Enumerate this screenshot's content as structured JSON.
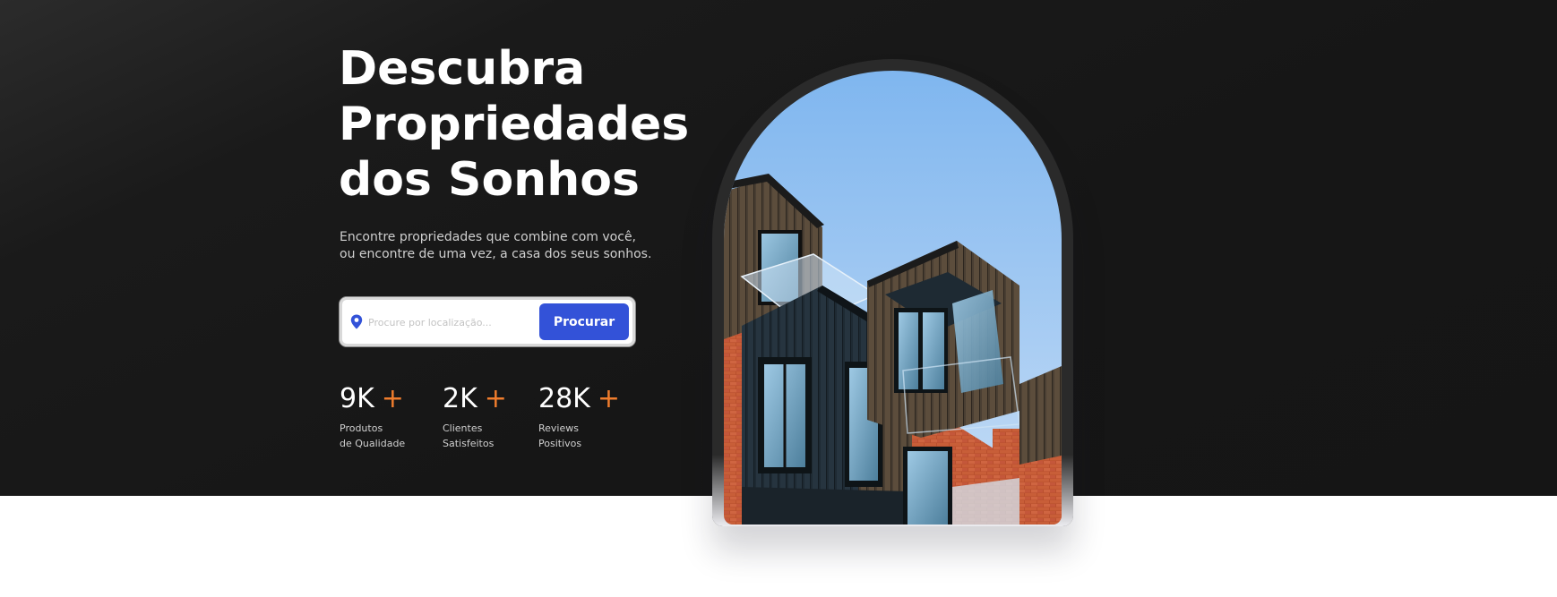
{
  "hero": {
    "title_lines": [
      "Descubra",
      "Propriedades",
      "dos Sonhos"
    ],
    "subtitle_lines": [
      "Encontre propriedades que combine com você,",
      "ou encontre de uma vez, a casa dos seus sonhos."
    ]
  },
  "search": {
    "placeholder": "Procure por localização...",
    "value": "",
    "button_label": "Procurar",
    "icon": "location-pin-icon"
  },
  "stats": [
    {
      "value": "9K",
      "plus": "+",
      "label_lines": [
        "Produtos",
        "de Qualidade"
      ]
    },
    {
      "value": "2K",
      "plus": "+",
      "label_lines": [
        "Clientes",
        "Satisfeitos"
      ]
    },
    {
      "value": "28K",
      "plus": "+",
      "label_lines": [
        "Reviews",
        "Positivos"
      ]
    }
  ],
  "colors": {
    "accent": "#3352d8",
    "plus": "#f07d2d",
    "hero_bg": "#161616",
    "text_light": "#ffffff",
    "text_muted": "#cfcfcf"
  }
}
